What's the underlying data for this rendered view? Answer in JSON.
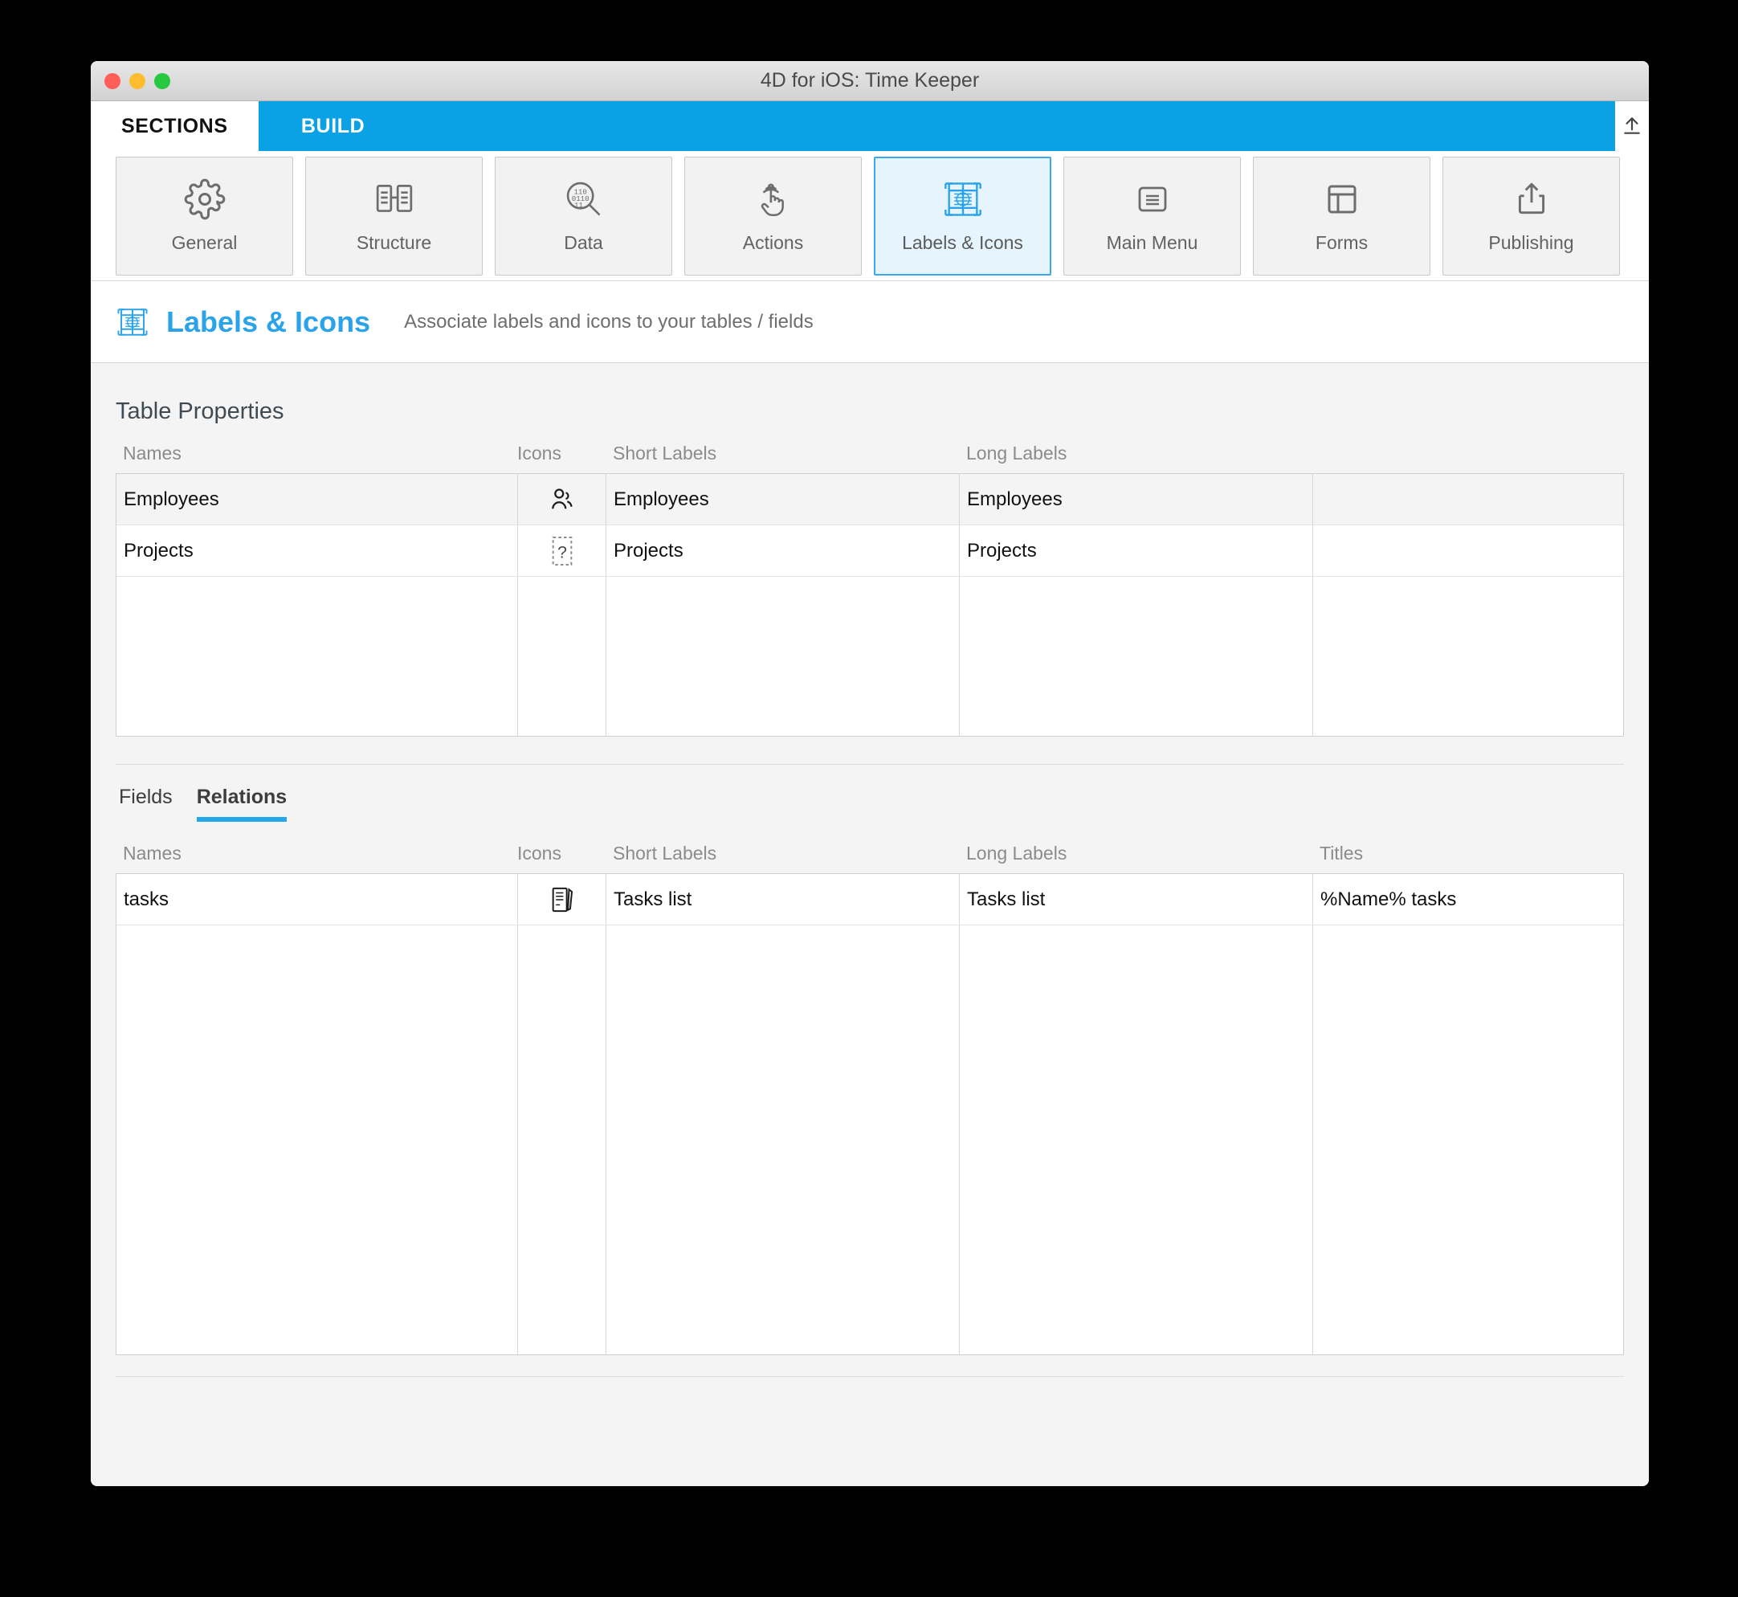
{
  "window": {
    "title": "4D for iOS: Time Keeper",
    "traffic_lights": [
      "close-button",
      "minimize-button",
      "zoom-button"
    ]
  },
  "tabbar": {
    "tabs": [
      {
        "label": "SECTIONS",
        "active": true
      },
      {
        "label": "BUILD",
        "active": false
      }
    ],
    "upload_icon": "upload-icon"
  },
  "sections": {
    "buttons": [
      {
        "label": "General",
        "icon": "gear-icon",
        "selected": false
      },
      {
        "label": "Structure",
        "icon": "structure-icon",
        "selected": false
      },
      {
        "label": "Data",
        "icon": "data-search-icon",
        "selected": false
      },
      {
        "label": "Actions",
        "icon": "tap-hand-icon",
        "selected": false
      },
      {
        "label": "Labels & Icons",
        "icon": "labels-grid-icon",
        "selected": true
      },
      {
        "label": "Main Menu",
        "icon": "hamburger-icon",
        "selected": false
      },
      {
        "label": "Forms",
        "icon": "layout-icon",
        "selected": false
      },
      {
        "label": "Publishing",
        "icon": "share-upload-icon",
        "selected": false
      }
    ]
  },
  "page_header": {
    "icon": "labels-grid-icon",
    "title": "Labels & Icons",
    "subtitle": "Associate labels and icons to your tables / fields"
  },
  "table_properties": {
    "title": "Table Properties",
    "columns": [
      "Names",
      "Icons",
      "Short Labels",
      "Long Labels",
      ""
    ],
    "rows": [
      {
        "name": "Employees",
        "icon": "people-icon",
        "short_label": "Employees",
        "long_label": "Employees",
        "extra": ""
      },
      {
        "name": "Projects",
        "icon": "placeholder-question-icon",
        "short_label": "Projects",
        "long_label": "Projects",
        "extra": ""
      }
    ]
  },
  "sub_tabs": [
    {
      "label": "Fields",
      "active": false
    },
    {
      "label": "Relations",
      "active": true
    }
  ],
  "relations": {
    "columns": [
      "Names",
      "Icons",
      "Short Labels",
      "Long Labels",
      "Titles"
    ],
    "rows": [
      {
        "name": "tasks",
        "icon": "tasks-list-icon",
        "short_label": "Tasks list",
        "long_label": "Tasks list",
        "title": "%Name% tasks"
      }
    ]
  },
  "colors": {
    "accent_blue": "#0aa2e5",
    "header_blue": "#2aa3e8",
    "selected_bg": "#e6f5fd",
    "selected_border": "#3aa9ef",
    "underline": "#23a8e8"
  }
}
